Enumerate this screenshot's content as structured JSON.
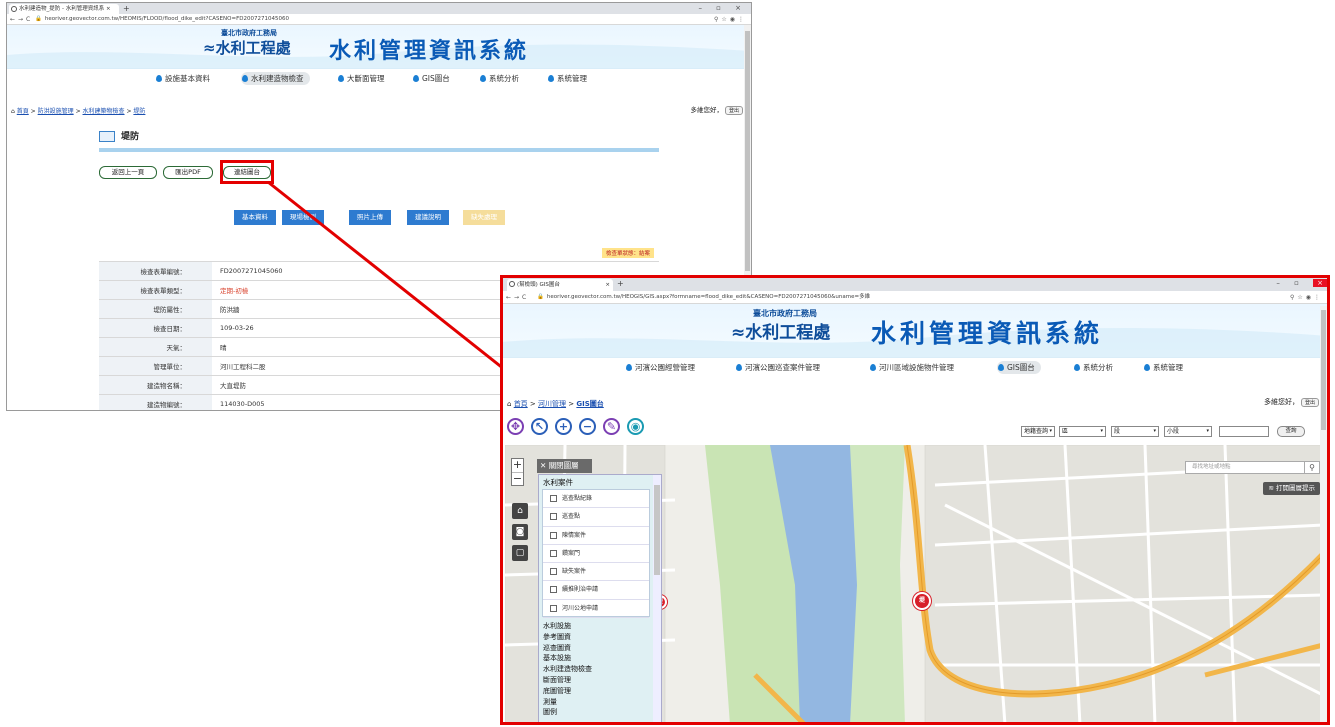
{
  "w1": {
    "tab_title": "水利建造物_提防 - 水利管理資訊系 ×",
    "url": "heoriver.geovector.com.tw/HEOMIS/FLOOD/flood_dike_edit?CASENO=FD2007271045060",
    "logo_small": "臺北市政府工務局",
    "logo_main": "水利工程處",
    "system_name": "水利管理資訊系統",
    "menu": [
      "設施基本資料",
      "水利建造物檢查",
      "大斷面管理",
      "GIS圖台",
      "系統分析",
      "系統管理"
    ],
    "breadcrumb": {
      "home": "首頁",
      "sep": ">",
      "c1": "防洪設施管理",
      "c2": "水利建築物檢查",
      "c3": "堤防"
    },
    "greeting": "多維您好，",
    "logout": "登出",
    "page_title": "堤防",
    "buttons": {
      "back": "返回上一頁",
      "pdf": "匯出PDF",
      "gis": "連結圖台"
    },
    "tabs": [
      "基本資料",
      "現場檢測",
      "照片上傳",
      "建議說明",
      "缺失處理"
    ],
    "status_badge": "檢查單狀態：結案",
    "rows": [
      {
        "k": "檢查表單編號：",
        "v": "FD2007271045060"
      },
      {
        "k": "檢查表單類型：",
        "v": "定期-初檢"
      },
      {
        "k": "堤防屬性：",
        "v": "防洪牆"
      },
      {
        "k": "檢查日期：",
        "v": "109-03-26"
      },
      {
        "k": "天氣：",
        "v": "晴"
      },
      {
        "k": "管理單位：",
        "v": "河川工程科二股"
      },
      {
        "k": "建造物名稱：",
        "v": "大直堤防"
      },
      {
        "k": "建造物編號：",
        "v": "114030-D005"
      }
    ]
  },
  "w2": {
    "tab_title": "(幫檢頭) GIS圖台",
    "url": "heoriver.geovector.com.tw/HEOGIS/GIS.aspx?formname=flood_dike_edit&CASENO=FD2007271045060&uname=多維",
    "logo_small": "臺北市政府工務局",
    "logo_main": "水利工程處",
    "system_name": "水利管理資訊系統",
    "menu": [
      "河濱公園經營管理",
      "河濱公園巡查案件管理",
      "河川區域設施物件管理",
      "GIS圖台",
      "系統分析",
      "系統管理"
    ],
    "breadcrumb": {
      "home": "首頁",
      "sep": ">",
      "c1": "河川管理",
      "c2": "GIS圖台"
    },
    "greeting": "多維您好，",
    "logout": "登出",
    "filters": {
      "f1": "地籍查詢",
      "f2": "區",
      "f3": "段",
      "f4": "小段",
      "query": "查詢"
    },
    "map": {
      "close_layers": "關閉圖層",
      "search_placeholder": "尋找地址或地點",
      "open_layers": "打開圖層提示",
      "layer_group": "水利案件",
      "layer_items": [
        "巡查點紀錄",
        "巡查點",
        "陳情案件",
        "鑽案門",
        "缺失案件",
        "續推則治申請",
        "河川公地申請"
      ],
      "groups": [
        "水利設施",
        "參考圖資",
        "巡查圖資",
        "基本設施",
        "水利建造物檢查",
        "斷面管理",
        "底圖管理",
        "測量",
        "圖例"
      ],
      "marker_label": "堤"
    }
  },
  "colors": {
    "highlight": "#e20000",
    "primary_tab": "#2e7bd0",
    "status_badge_bg": "#ffe38a",
    "map_river": "#93b7e1",
    "map_road": "#f2b64a"
  }
}
